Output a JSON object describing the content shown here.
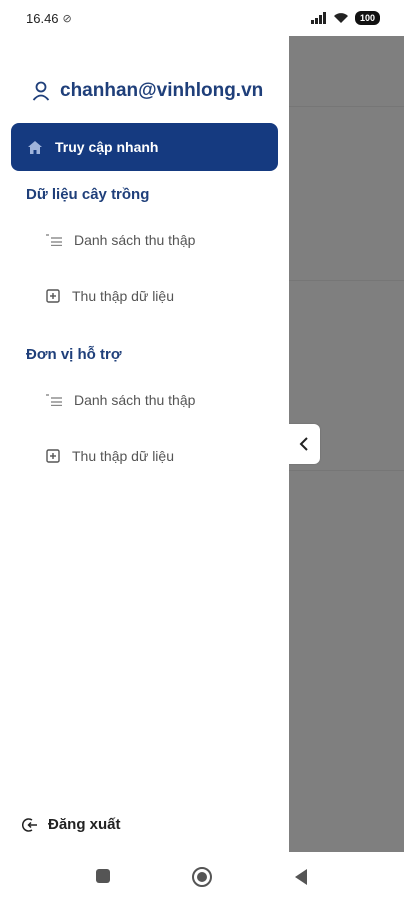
{
  "status": {
    "time": "16.46",
    "battery": "100"
  },
  "drawer": {
    "account_email": "chanhan@vinhlong.vn",
    "quick_access_label": "Truy cập nhanh",
    "sections": [
      {
        "title": "Dữ liệu cây trồng",
        "items": [
          "Danh sách thu thập",
          "Thu thập dữ liệu"
        ]
      },
      {
        "title": "Đơn vị hỗ trợ",
        "items": [
          "Danh sách thu thập",
          "Thu thập dữ liệu"
        ]
      }
    ],
    "logout_label": "Đăng xuất"
  },
  "colors": {
    "accent": "#153a80",
    "text_primary": "#1f3f7a",
    "overlay": "#7f7f7f"
  },
  "icons": [
    "user-icon",
    "home-icon",
    "list-icon",
    "add-box-icon",
    "logout-icon",
    "chevron-left-icon",
    "nav-recent-icon",
    "nav-home-icon",
    "nav-back-icon"
  ]
}
